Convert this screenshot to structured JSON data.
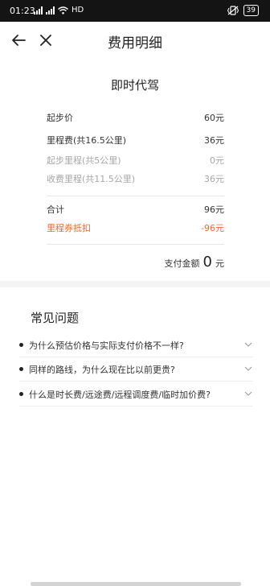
{
  "status_bar": {
    "time": "01:23",
    "network": "HD",
    "battery": "39"
  },
  "nav": {
    "title": "费用明细",
    "back_icon": "arrow-left-icon",
    "close_icon": "close-icon"
  },
  "fee": {
    "service": "即时代驾",
    "rows": [
      {
        "label": "起步价",
        "value": "60元"
      },
      {
        "label": "里程费(共16.5公里)",
        "value": "36元"
      },
      {
        "label": "起步里程(共5公里)",
        "value": "0元"
      },
      {
        "label": "收费里程(共11.5公里)",
        "value": "36元"
      },
      {
        "label": "合计",
        "value": "96元"
      },
      {
        "label": "里程券抵扣",
        "value": "-96元"
      }
    ],
    "pay_label": "支付金额",
    "pay_amount": "0",
    "pay_unit": "元"
  },
  "faq": {
    "title": "常见问题",
    "items": [
      {
        "question": "为什么预估价格与实际支付价格不一样?"
      },
      {
        "question": "同样的路线，为什么现在比以前更贵?"
      },
      {
        "question": "什么是时长费/远途费/远程调度费/临时加价费?"
      }
    ]
  },
  "colors": {
    "accent_orange": "#ee6b2d",
    "muted_gray": "#a6a6a6",
    "status_bar": "#141414"
  }
}
